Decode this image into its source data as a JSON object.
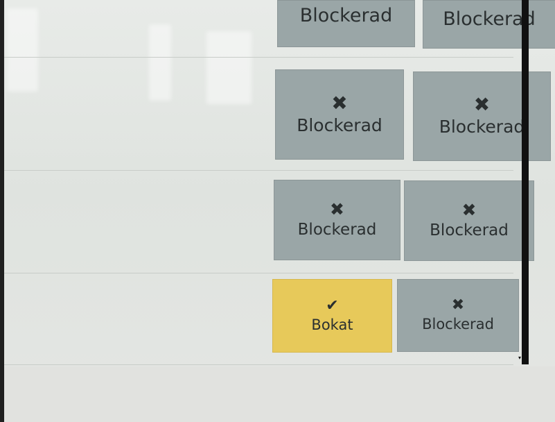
{
  "tiles": [
    {
      "status": "blocked",
      "icon": "✖",
      "icon_name": "x-icon",
      "label": "Blockerad"
    },
    {
      "status": "blocked",
      "icon": "✖",
      "icon_name": "x-icon",
      "label": "Blockerad"
    },
    {
      "status": "blocked",
      "icon": "✖",
      "icon_name": "x-icon",
      "label": "Blockerad"
    },
    {
      "status": "blocked",
      "icon": "✖",
      "icon_name": "x-icon",
      "label": "Blockerad"
    },
    {
      "status": "blocked",
      "icon": "✖",
      "icon_name": "x-icon",
      "label": "Blockerad"
    },
    {
      "status": "blocked",
      "icon": "✖",
      "icon_name": "x-icon",
      "label": "Blockerad"
    },
    {
      "status": "booked",
      "icon": "✔",
      "icon_name": "check-icon",
      "label": "Bokat"
    },
    {
      "status": "blocked",
      "icon": "✖",
      "icon_name": "x-icon",
      "label": "Blockerad"
    }
  ],
  "scrollbar": {
    "arrow": "▾"
  },
  "colors": {
    "blocked": "#9aa6a7",
    "booked": "#e7c95a",
    "text": "#2a2f30"
  }
}
